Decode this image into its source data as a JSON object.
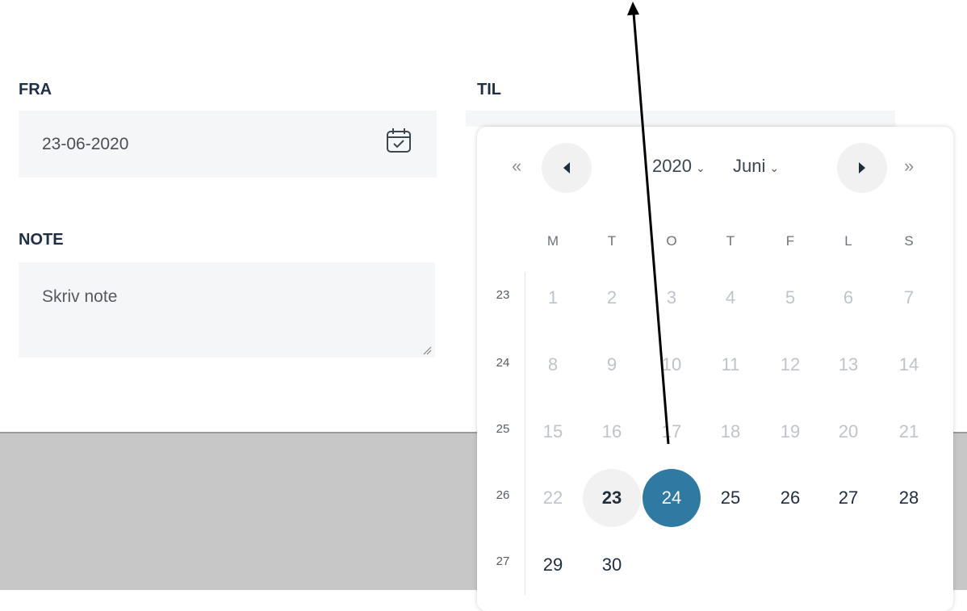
{
  "form": {
    "from_label": "FRA",
    "from_value": "23-06-2020",
    "to_label": "TIL",
    "note_label": "NOTE",
    "note_placeholder": "Skriv note"
  },
  "picker": {
    "prev_year": "«",
    "next_year": "»",
    "year": "2020",
    "month": "Juni",
    "weekdays": [
      "M",
      "T",
      "O",
      "T",
      "F",
      "L",
      "S"
    ],
    "weeks": [
      {
        "week": "23",
        "days": [
          "1",
          "2",
          "3",
          "4",
          "5",
          "6",
          "7"
        ]
      },
      {
        "week": "24",
        "days": [
          "8",
          "9",
          "10",
          "11",
          "12",
          "13",
          "14"
        ]
      },
      {
        "week": "25",
        "days": [
          "15",
          "16",
          "17",
          "18",
          "19",
          "20",
          "21"
        ]
      },
      {
        "week": "26",
        "days": [
          "22",
          "23",
          "24",
          "25",
          "26",
          "27",
          "28"
        ]
      },
      {
        "week": "27",
        "days": [
          "29",
          "30"
        ]
      }
    ],
    "today": "23",
    "selected": "24",
    "selected_color": "#2f7aa3"
  }
}
